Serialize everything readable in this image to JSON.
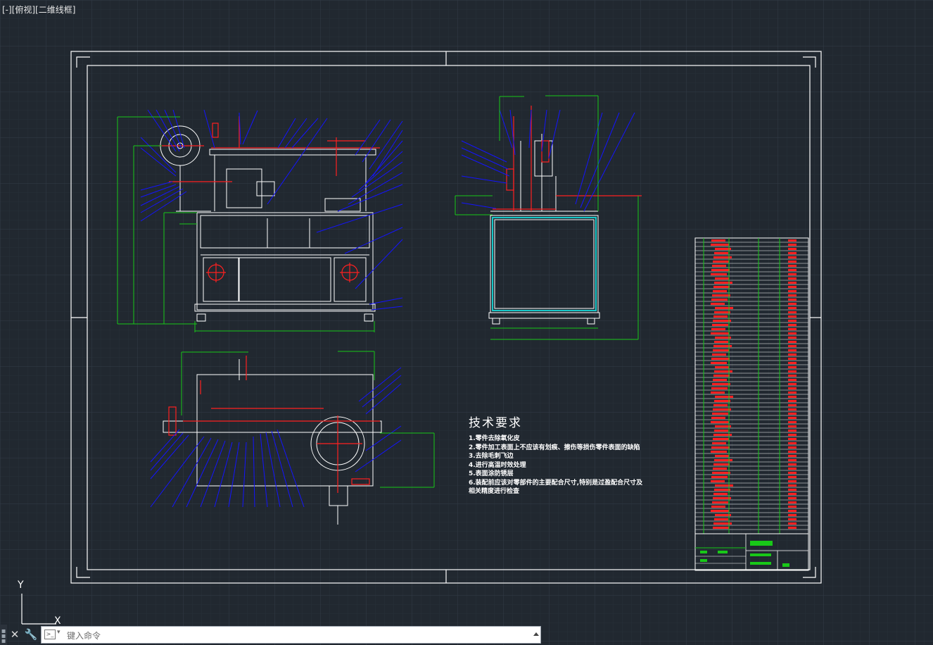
{
  "viewport": {
    "label": "[-][俯视][二维线框]"
  },
  "ucs": {
    "y_label": "Y",
    "x_label": "X"
  },
  "tech_notes": {
    "title": "技术要求",
    "lines": [
      "1.零件去除氧化皮",
      "2.零件加工表面上不应该有划痕、擦伤等损伤零件表面的缺陷",
      "3.去除毛刺飞边",
      "4.进行高温时效处理",
      "5.表面涂防锈层",
      "6.装配前应该对零部件的主要配合尺寸,特别是过盈配合尺寸及",
      "相关精度进行检查"
    ]
  },
  "command_line": {
    "placeholder": "键入命令"
  },
  "colors": {
    "background": "#212830",
    "frame": "#ffffff",
    "leader": "#1414ff",
    "dimension": "#18c818",
    "part_red": "#ff1e1e",
    "text": "#ffffff"
  },
  "icons": {
    "close": "close-icon",
    "customize": "wrench-icon",
    "history": "command-history-icon"
  }
}
